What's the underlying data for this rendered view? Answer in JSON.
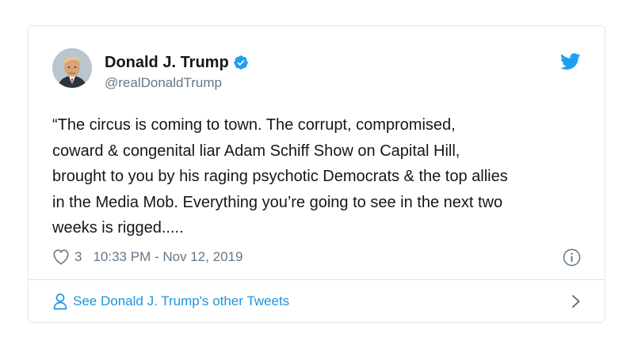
{
  "tweet": {
    "author_name": "Donald J. Trump",
    "handle": "@realDonaldTrump",
    "text": "“The circus is coming to town. The corrupt, compromised,\ncoward & congenital liar Adam Schiff Show on Capital Hill,\nbrought to you by his raging psychotic Democrats & the top allies\nin the Media Mob. Everything you’re going to see in the next two\nweeks is rigged.....",
    "like_count": "3",
    "timestamp": "10:33 PM - Nov 12, 2019",
    "verified": true
  },
  "footer": {
    "link_label": "See Donald J. Trump's other Tweets"
  },
  "icons": {
    "verified": "verified-badge-icon",
    "brand": "twitter-bird-icon",
    "like": "heart-icon",
    "info": "info-icon",
    "profile": "person-icon",
    "chevron": "chevron-right-icon"
  },
  "colors": {
    "brand_blue": "#1da1f2",
    "link_blue": "#1b95e0",
    "text_primary": "#14171a",
    "text_secondary": "#657786",
    "border": "#e1e8ed"
  }
}
